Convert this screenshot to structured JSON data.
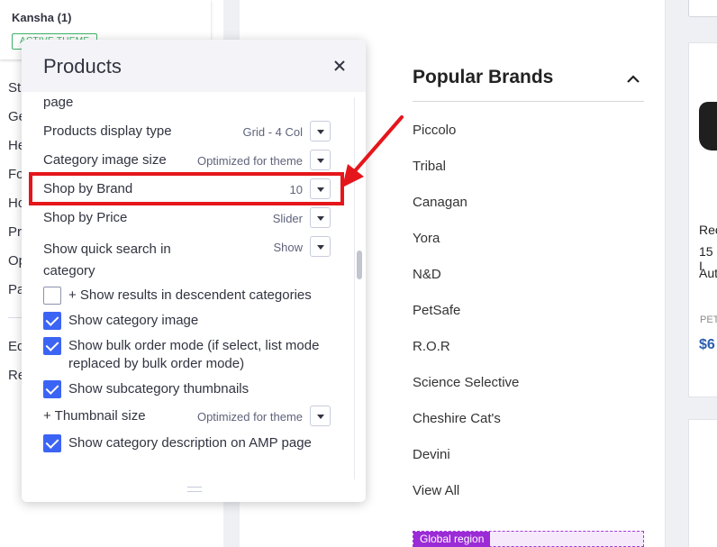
{
  "sidebar": {
    "theme_name": "Kansha (1)",
    "theme_badge": "ACTIVE THEME",
    "stubs": [
      "St",
      "Ge",
      "He",
      "Fo",
      "Ho",
      "Pr",
      "Op",
      "Pa",
      "Ed",
      "Re"
    ]
  },
  "panel": {
    "title": "Products",
    "close_icon": "close-icon",
    "cut_label": "page",
    "options": [
      {
        "label": "Products display type",
        "value": "Grid - 4 Col"
      },
      {
        "label": "Category image size",
        "value": "Optimized for theme"
      },
      {
        "label": "Shop by Brand",
        "value": "10"
      },
      {
        "label": "Shop by Price",
        "value": "Slider"
      },
      {
        "label": "Show quick search in category",
        "value": "Show"
      }
    ],
    "checkboxes": [
      {
        "label": "+ Show results in descendent categories",
        "checked": false
      },
      {
        "label": "Show category image",
        "checked": true
      },
      {
        "label": "Show bulk order mode (if select, list mode replaced by bulk order mode)",
        "checked": true
      },
      {
        "label": "Show subcategory thumbnails",
        "checked": true
      }
    ],
    "thumbnail_size": {
      "label": "+ Thumbnail size",
      "value": "Optimized for theme"
    },
    "amp_checkbox": {
      "label": "Show category description on AMP page",
      "checked": true
    }
  },
  "store": {
    "popular_title": "Popular Brands",
    "brands": [
      "Piccolo",
      "Tribal",
      "Canagan",
      "Yora",
      "N&D",
      "PetSafe",
      "R.O.R",
      "Science Selective",
      "Cheshire Cat's",
      "Devini"
    ],
    "view_all": "View All",
    "global_region": "Global region",
    "product_lines": [
      "Rec",
      "15 I",
      "Aut"
    ],
    "product_brand": "PET",
    "product_price": "$6"
  },
  "colors": {
    "accent": "#3c64f4",
    "highlight": "#e5161b",
    "global_region": "#9b2bd6",
    "badge": "#3fb26a"
  }
}
